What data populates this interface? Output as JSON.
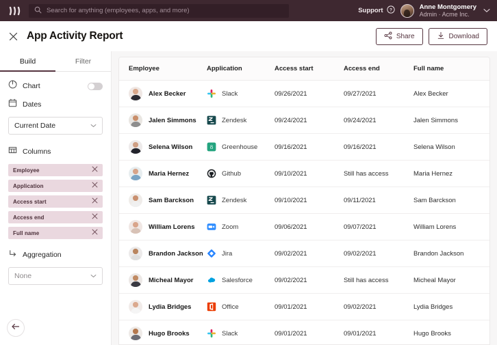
{
  "topbar": {
    "logo_icon": "brand-wave-logo",
    "search": {
      "placeholder": "Search for anything (employees, apps, and more)",
      "value": "",
      "icon": "search-icon"
    },
    "support_label": "Support",
    "support_icon": "question-circle-icon",
    "user": {
      "name": "Anne Montgomery",
      "role": "Admin · Acme Inc.",
      "avatar_icon": "user-avatar"
    },
    "caret_icon": "chevron-down-icon"
  },
  "titlebar": {
    "close_icon": "close-icon",
    "title": "App Activity Report",
    "share_label": "Share",
    "share_icon": "share-icon",
    "download_label": "Download",
    "download_icon": "download-icon"
  },
  "sidebar": {
    "tabs": [
      {
        "label": "Build",
        "active": true
      },
      {
        "label": "Filter",
        "active": false
      }
    ],
    "chart": {
      "label": "Chart",
      "icon": "pie-chart-icon",
      "toggle_on": false
    },
    "dates": {
      "label": "Dates",
      "icon": "calendar-icon",
      "selected": "Current Date",
      "caret_icon": "chevron-down-icon"
    },
    "columns": {
      "label": "Columns",
      "icon": "table-columns-icon",
      "chips": [
        {
          "label": "Employee",
          "remove_icon": "close-icon"
        },
        {
          "label": "Application",
          "remove_icon": "close-icon"
        },
        {
          "label": "Access start",
          "remove_icon": "close-icon"
        },
        {
          "label": "Access end",
          "remove_icon": "close-icon"
        },
        {
          "label": "Full name",
          "remove_icon": "close-icon"
        }
      ]
    },
    "aggregation": {
      "label": "Aggregation",
      "icon": "arrow-branch-icon",
      "selected": "None",
      "caret_icon": "chevron-down-icon"
    },
    "back_button_icon": "arrow-left-icon"
  },
  "table": {
    "columns": [
      "Employee",
      "Application",
      "Access start",
      "Access end",
      "Full name"
    ],
    "rows": [
      {
        "employee": "Alex Becker",
        "application": "Slack",
        "app_icon": "slack-icon",
        "access_start": "09/26/2021",
        "access_end": "09/27/2021",
        "full_name": "Alex Becker"
      },
      {
        "employee": "Jalen Simmons",
        "application": "Zendesk",
        "app_icon": "zendesk-icon",
        "access_start": "09/24/2021",
        "access_end": "09/24/2021",
        "full_name": "Jalen Simmons"
      },
      {
        "employee": "Selena Wilson",
        "application": "Greenhouse",
        "app_icon": "greenhouse-icon",
        "access_start": "09/16/2021",
        "access_end": "09/16/2021",
        "full_name": "Selena Wilson"
      },
      {
        "employee": "Maria Hernez",
        "application": "Github",
        "app_icon": "github-icon",
        "access_start": "09/10/2021",
        "access_end": "Still has access",
        "full_name": "Maria Hernez"
      },
      {
        "employee": "Sam Barckson",
        "application": "Zendesk",
        "app_icon": "zendesk-icon",
        "access_start": "09/10/2021",
        "access_end": "09/11/2021",
        "full_name": "Sam Barckson"
      },
      {
        "employee": "William Lorens",
        "application": "Zoom",
        "app_icon": "zoom-icon",
        "access_start": "09/06/2021",
        "access_end": "09/07/2021",
        "full_name": "William Lorens"
      },
      {
        "employee": "Brandon Jackson",
        "application": "Jira",
        "app_icon": "jira-icon",
        "access_start": "09/02/2021",
        "access_end": "09/02/2021",
        "full_name": "Brandon Jackson"
      },
      {
        "employee": "Micheal Mayor",
        "application": "Salesforce",
        "app_icon": "salesforce-icon",
        "access_start": "09/02/2021",
        "access_end": "Still has access",
        "full_name": "Micheal Mayor"
      },
      {
        "employee": "Lydia Bridges",
        "application": "Office",
        "app_icon": "office-icon",
        "access_start": "09/01/2021",
        "access_end": "09/02/2021",
        "full_name": "Lydia Bridges"
      },
      {
        "employee": "Hugo Brooks",
        "application": "Slack",
        "app_icon": "slack-icon",
        "access_start": "09/01/2021",
        "access_end": "09/01/2021",
        "full_name": "Hugo Brooks"
      }
    ]
  },
  "colors": {
    "header_bg": "#3e2830",
    "accent": "#55343f",
    "chip_bg": "#ead8df",
    "panel_bg": "#f7f6f6"
  }
}
